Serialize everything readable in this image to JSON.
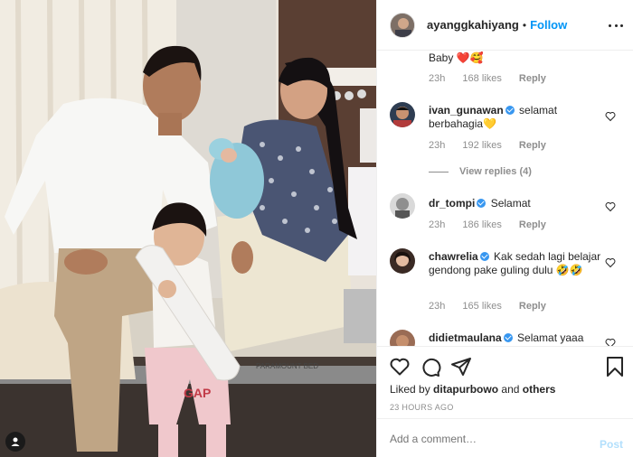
{
  "post": {
    "username": "ayanggkahiyang",
    "separator": "•",
    "follow_label": "Follow",
    "more_icon": "more-icon"
  },
  "comments": [
    {
      "username": "",
      "text": "Baby ❤️🥰",
      "time": "23h",
      "likes": "168 likes",
      "reply": "Reply",
      "verified": false
    },
    {
      "username": "ivan_gunawan",
      "text": "selamat berbahagia💛",
      "time": "23h",
      "likes": "192 likes",
      "reply": "Reply",
      "verified": true,
      "view_replies": "View replies (4)"
    },
    {
      "username": "dr_tompi",
      "text": "Selamat",
      "time": "23h",
      "likes": "186 likes",
      "reply": "Reply",
      "verified": true
    },
    {
      "username": "chawrelia",
      "text": "Kak sedah lagi belajar gendong pake guling dulu 🤣🤣",
      "time": "23h",
      "likes": "165 likes",
      "reply": "Reply",
      "verified": true
    },
    {
      "username": "didietmaulana",
      "text": "Selamat yaaa",
      "verified": true
    }
  ],
  "actions": {
    "liked_by_prefix": "Liked by",
    "liked_by_user": "ditapurbowo",
    "liked_by_and": "and",
    "liked_by_others": "others",
    "time_ago": "23 HOURS AGO",
    "comment_placeholder": "Add a comment…",
    "post_label": "Post"
  },
  "photo": {
    "bed_label": "PARAMOUNT BED",
    "shirt_label": "GAP"
  },
  "colors": {
    "link_blue": "#0095f6",
    "post_disabled": "#b2dffc",
    "verified_blue": "#3897f0",
    "muted": "#8e8e8e"
  }
}
